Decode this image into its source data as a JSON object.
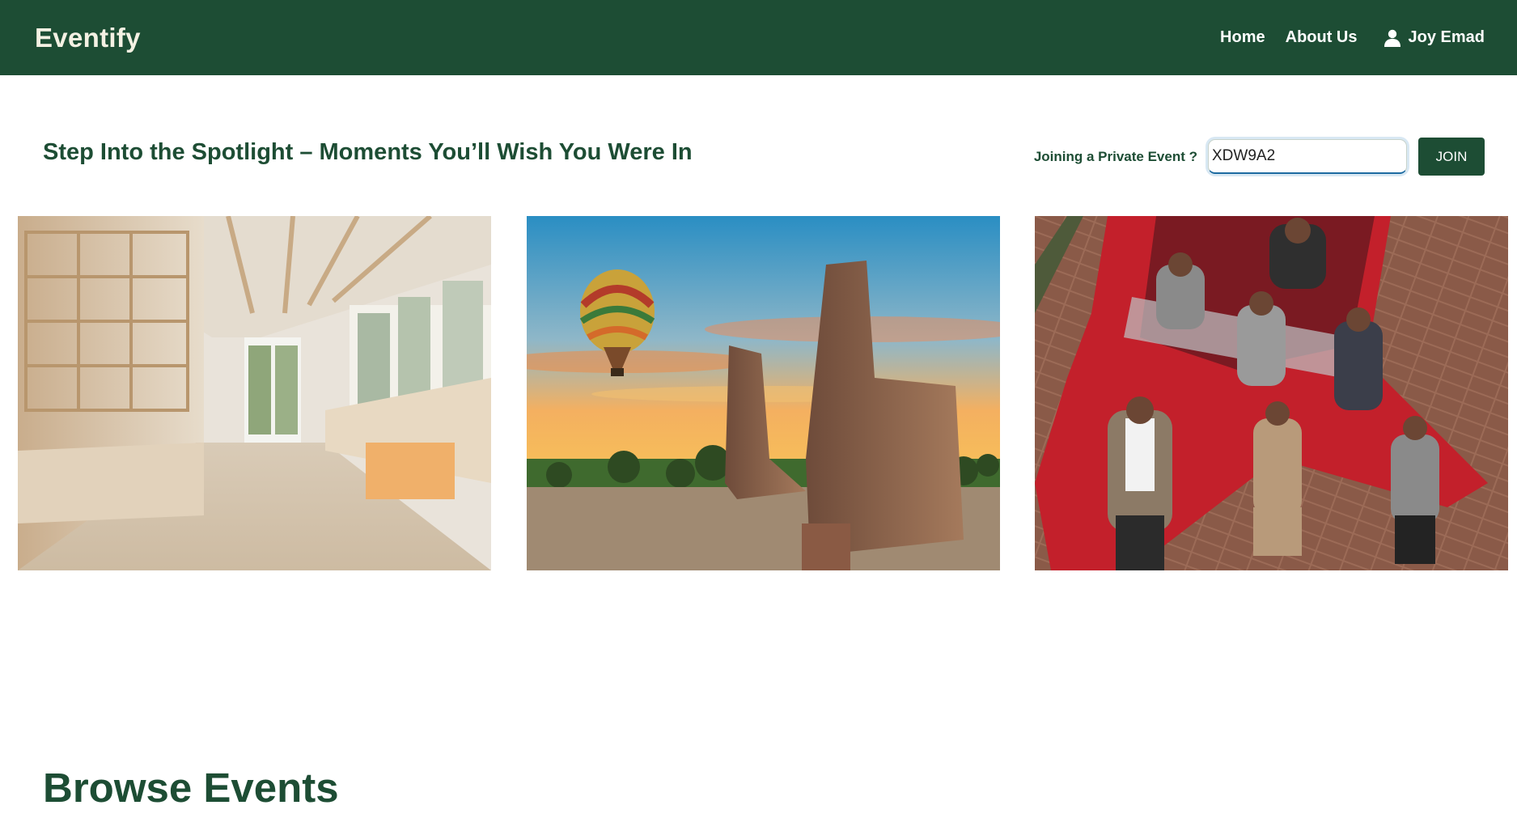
{
  "navbar": {
    "brand": "Eventify",
    "links": [
      {
        "label": "Home"
      },
      {
        "label": "About Us"
      }
    ],
    "user": {
      "name": "Joy Emad",
      "icon": "user-icon"
    }
  },
  "hero": {
    "tagline": "Step Into the Spotlight – Moments You’ll Wish You Were In"
  },
  "private_event": {
    "label": "Joining a Private Event ?",
    "code_value": "XDW9A2",
    "join_label": "JOIN"
  },
  "gallery": {
    "images": [
      {
        "subject": "wooden interior hall"
      },
      {
        "subject": "colossi statues with hot air balloon at sunset"
      },
      {
        "subject": "group of men around a red convertible car"
      }
    ]
  },
  "sections": {
    "browse_title": "Browse Events"
  },
  "colors": {
    "brand_green": "#1d4d34",
    "focus_blue": "#1c6aa0"
  }
}
